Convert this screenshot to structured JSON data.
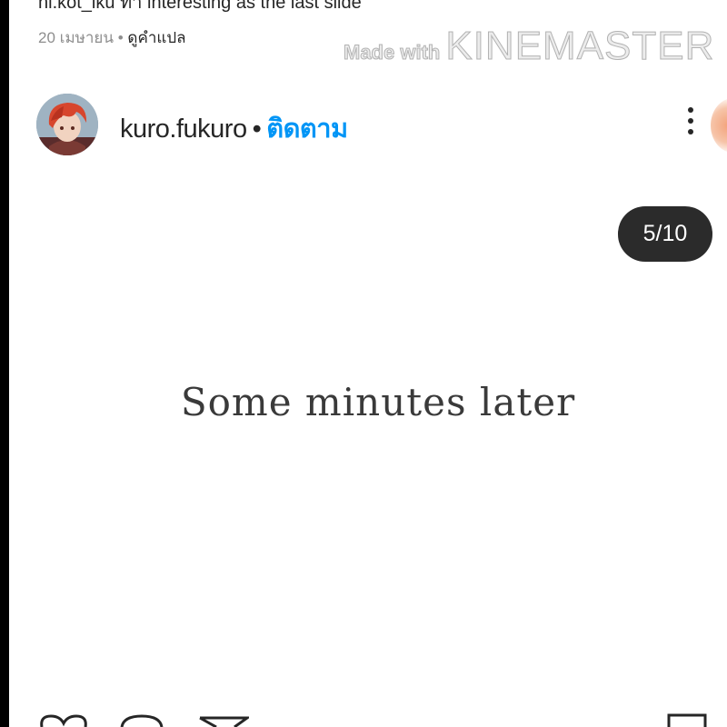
{
  "previous_post": {
    "caption": "hi.kot_iku ทำ interesting as the last slide",
    "date": "20 เมษายน",
    "separator": "•",
    "translate_label": "ดูคำแปล"
  },
  "watermark": {
    "small": "Made with",
    "big": "KINEMASTER"
  },
  "post": {
    "username": "kuro.fukuro",
    "separator": "•",
    "follow_label": "ติดตาม",
    "carousel_counter": "5/10",
    "slide_text": "Some minutes later"
  },
  "icons": {
    "more": "more-vertical-icon",
    "like": "heart-icon",
    "comment": "comment-icon",
    "share": "send-icon",
    "save": "bookmark-icon"
  },
  "colors": {
    "link_blue": "#0095f6",
    "counter_bg": "#2b2b2b",
    "text": "#262626",
    "muted": "#8e8e8e"
  }
}
